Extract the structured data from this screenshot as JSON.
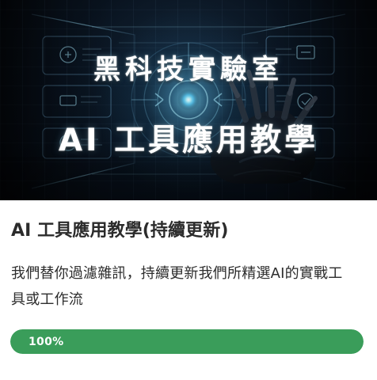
{
  "hero": {
    "title": "黑科技實驗室",
    "subtitle": "AI 工具應用教學"
  },
  "course": {
    "title": "AI 工具應用教學(持續更新)",
    "description": "我們替你過濾雜訊，持續更新我們所精選AI的實戰工具或工作流"
  },
  "progress": {
    "value": 100,
    "label": "100%"
  },
  "colors": {
    "accent_green": "#3a9d5a",
    "track_green": "#d9efe0",
    "hero_glow": "#6ad2ff",
    "text_primary": "#2b2b2b"
  }
}
